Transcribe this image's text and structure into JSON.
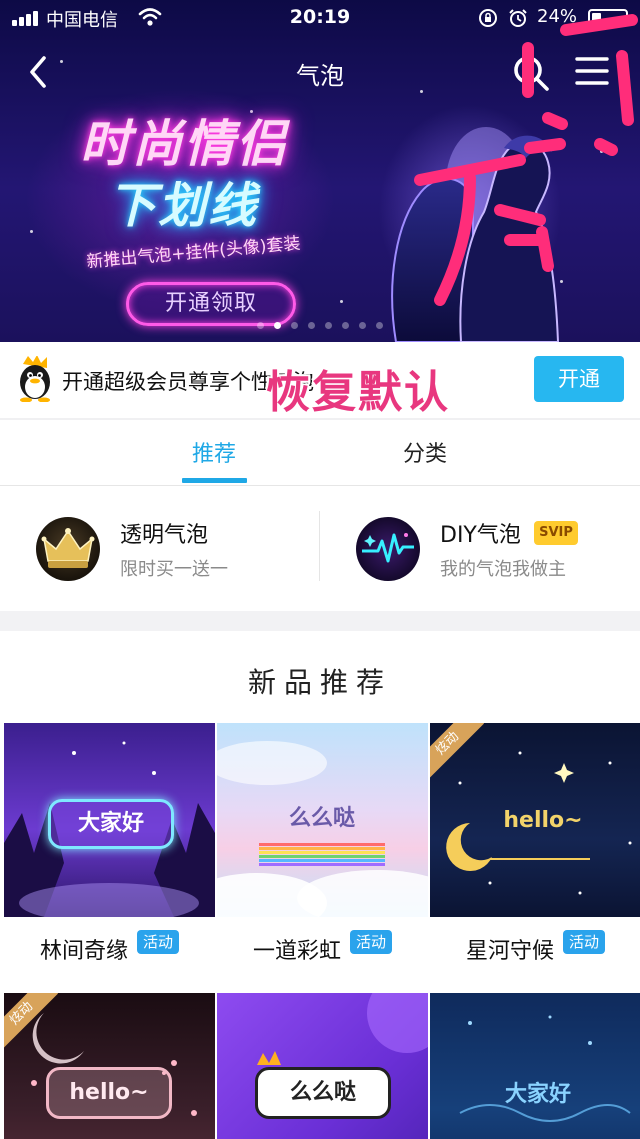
{
  "status_bar": {
    "carrier": "中国电信",
    "time": "20:19",
    "battery": "24%"
  },
  "nav": {
    "title": "气泡"
  },
  "banner": {
    "headline_line1": "时尚情侣",
    "headline_line2": "下划线",
    "subtitle": "新推出气泡+挂件(头像)套装",
    "button_label": "开通领取",
    "page_count": 8,
    "active_page": 1
  },
  "vip": {
    "text": "开通超级会员尊享个性气泡",
    "overlay_label": "恢复默认",
    "button_label": "开通"
  },
  "tabs": [
    {
      "label": "推荐",
      "active": true
    },
    {
      "label": "分类",
      "active": false
    }
  ],
  "features": [
    {
      "title": "透明气泡",
      "subtitle": "限时买一送一",
      "icon": "crown-icon"
    },
    {
      "title": "DIY气泡",
      "badge": "SVIP",
      "subtitle": "我的气泡我做主",
      "icon": "heartbeat-icon"
    }
  ],
  "new_items": {
    "title": "新品推荐",
    "items": [
      {
        "name": "林间奇缘",
        "badge": "活动",
        "bubble_text": "大家好",
        "corner_tag": ""
      },
      {
        "name": "一道彩虹",
        "badge": "活动",
        "bubble_text": "么么哒",
        "corner_tag": ""
      },
      {
        "name": "星河守候",
        "badge": "活动",
        "bubble_text": "hello~",
        "corner_tag": "炫动"
      },
      {
        "name": "",
        "badge": "",
        "bubble_text": "hello~",
        "corner_tag": "炫动"
      },
      {
        "name": "",
        "badge": "",
        "bubble_text": "么么哒",
        "corner_tag": ""
      },
      {
        "name": "",
        "badge": "",
        "bubble_text": "大家好",
        "corner_tag": ""
      }
    ]
  },
  "colors": {
    "accent_blue": "#1fa8e6",
    "button_blue": "#27b7f0",
    "badge_blue": "#2aa3ec",
    "svip_yellow": "#ffcb2e",
    "overlay_pink": "#e8377f"
  }
}
